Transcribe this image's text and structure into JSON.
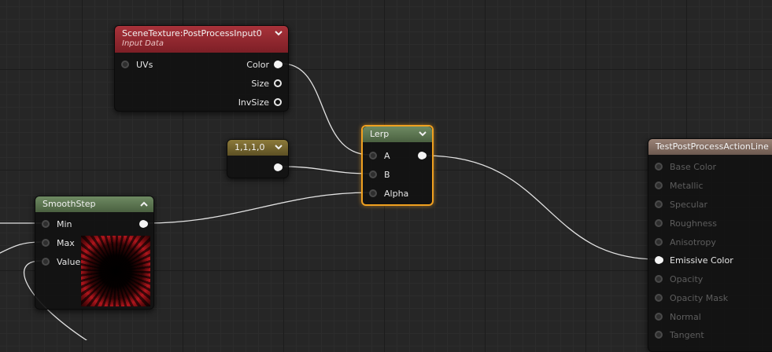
{
  "nodes": {
    "scene_texture": {
      "title": "SceneTexture:PostProcessInput0",
      "subtitle": "Input Data",
      "inputs": [
        {
          "label": "UVs"
        }
      ],
      "outputs": [
        {
          "label": "Color"
        },
        {
          "label": "Size"
        },
        {
          "label": "InvSize"
        }
      ]
    },
    "constant": {
      "title": "1,1,1,0"
    },
    "lerp": {
      "title": "Lerp",
      "inputs": [
        {
          "label": "A"
        },
        {
          "label": "B"
        },
        {
          "label": "Alpha"
        }
      ]
    },
    "smoothstep": {
      "title": "SmoothStep",
      "inputs": [
        {
          "label": "Min"
        },
        {
          "label": "Max"
        },
        {
          "label": "Value"
        }
      ]
    },
    "material": {
      "title": "TestPostProcessActionLine",
      "inputs": [
        {
          "label": "Base Color"
        },
        {
          "label": "Metallic"
        },
        {
          "label": "Specular"
        },
        {
          "label": "Roughness"
        },
        {
          "label": "Anisotropy"
        },
        {
          "label": "Emissive Color"
        },
        {
          "label": "Opacity"
        },
        {
          "label": "Opacity Mask"
        },
        {
          "label": "Normal"
        },
        {
          "label": "Tangent"
        }
      ]
    }
  },
  "icons": {
    "collapse": "chevron-down-icon",
    "expand": "chevron-up-icon"
  },
  "colors": {
    "background": "#262626",
    "scene_texture_header": "#a8323a",
    "lerp_header": "#6e8a62",
    "constant_header": "#8c7a3a",
    "material_header": "#9a8276",
    "selection": "#f0a020",
    "wire": "#e6e6e6"
  }
}
